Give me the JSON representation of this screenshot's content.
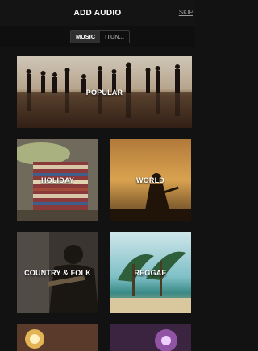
{
  "header": {
    "title": "ADD AUDIO",
    "skip_label": "SKIP"
  },
  "source_tabs": [
    {
      "label": "MUSIC",
      "active": true
    },
    {
      "label": "ITUN...",
      "active": false
    }
  ],
  "genres": [
    {
      "label": "POPULAR"
    },
    {
      "label": "HOLIDAY"
    },
    {
      "label": "WORLD"
    },
    {
      "label": "COUNTRY & FOLK"
    },
    {
      "label": "REGGAE"
    }
  ]
}
